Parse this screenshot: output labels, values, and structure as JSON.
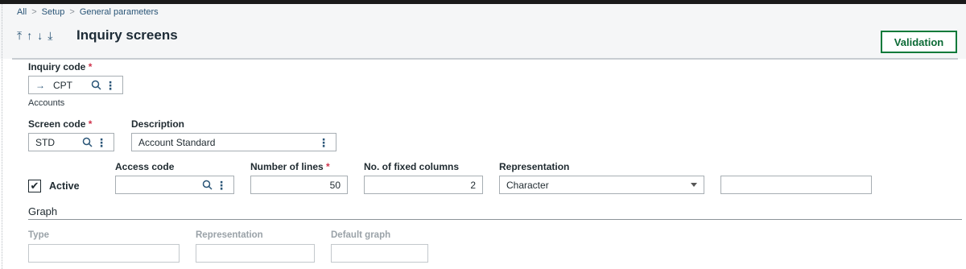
{
  "breadcrumb": [
    "All",
    "Setup",
    "General parameters"
  ],
  "header": {
    "nav_arrows": [
      "⤒",
      "↑",
      "↓",
      "⤓"
    ],
    "title": "Inquiry screens",
    "validation_label": "Validation"
  },
  "inquiry": {
    "label": "Inquiry code",
    "required_mark": "*",
    "arrow": "→",
    "value": "CPT",
    "caption": "Accounts"
  },
  "screen": {
    "label": "Screen code",
    "required_mark": "*",
    "value": "STD"
  },
  "description": {
    "label": "Description",
    "value": "Account Standard"
  },
  "active": {
    "label": "Active",
    "checked": true,
    "check_glyph": "✔"
  },
  "access": {
    "label": "Access code",
    "value": ""
  },
  "lines": {
    "label": "Number of lines",
    "required_mark": "*",
    "value": "50"
  },
  "fixed_columns": {
    "label": "No. of fixed columns",
    "value": "2"
  },
  "representation": {
    "label": "Representation",
    "value": "Character"
  },
  "graph": {
    "section_title": "Graph",
    "type_label": "Type",
    "representation_label": "Representation",
    "default_label": "Default graph"
  },
  "colors": {
    "accent": "#2a5577",
    "validate": "#0b7a3a",
    "required": "#d0334b"
  }
}
